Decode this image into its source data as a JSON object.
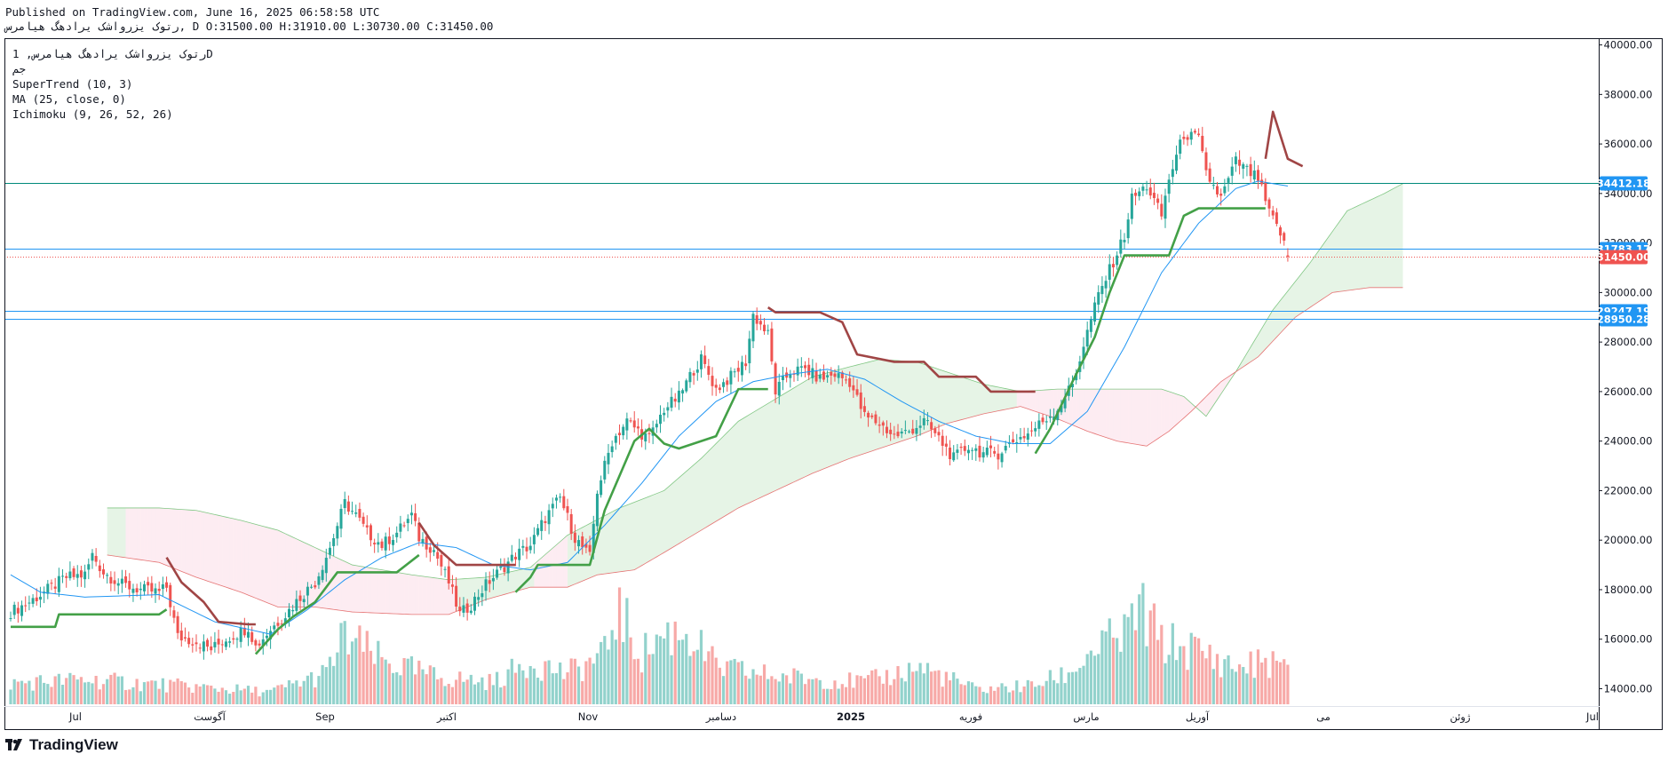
{
  "header": {
    "published": "Published on TradingView.com, June 16, 2025 06:58:58 UTC",
    "ohlc": "رتوک یزرواشک یرادهگ هیامرس, D O:31500.00 H:31910.00 L:30730.00 C:31450.00"
  },
  "legend": {
    "symbol": "رتوک یزرواشک یرادهگ هیامرس, 1D",
    "sub": "جم",
    "supertrend": "SuperTrend (10, 3)",
    "ma": "MA (25, close, 0)",
    "ichimoku": "Ichimoku (9, 26, 52, 26)"
  },
  "footer": {
    "brand": "TradingView"
  },
  "colors": {
    "up": "#26a69a",
    "down": "#ef5350",
    "ma": "#2196f3",
    "supertrend_up": "#43a047",
    "supertrend_down": "#a04545",
    "kumo_bull": "#a5d6a7",
    "kumo_bear": "#f8bbd0",
    "hline_teal": "#00897b",
    "hline_blue": "#2196f3",
    "last_price": "#ef5350"
  },
  "chart_data": {
    "type": "candlestick",
    "y_axis": {
      "min": 13300,
      "max": 40200,
      "ticks": [
        "40000.00",
        "38000.00",
        "36000.00",
        "34000.00",
        "32000.00",
        "30000.00",
        "28000.00",
        "26000.00",
        "24000.00",
        "22000.00",
        "20000.00",
        "18000.00",
        "16000.00",
        "14000.00"
      ]
    },
    "x_axis": {
      "labels": [
        "Jul",
        "آگوست",
        "Sep",
        "اکتبر",
        "Nov",
        "دسامبر",
        "2025",
        "فوریه",
        "مارس",
        "آوریل",
        "می",
        "ژوئن",
        "Jul"
      ]
    },
    "close_path": [
      [
        0,
        17100
      ],
      [
        5,
        17500
      ],
      [
        10,
        18000
      ],
      [
        15,
        18500
      ],
      [
        20,
        18600
      ],
      [
        22,
        19400
      ],
      [
        25,
        18700
      ],
      [
        30,
        18200
      ],
      [
        35,
        18000
      ],
      [
        40,
        17900
      ],
      [
        42,
        18100
      ],
      [
        45,
        16100
      ],
      [
        50,
        15900
      ],
      [
        54,
        15600
      ],
      [
        58,
        16000
      ],
      [
        62,
        16300
      ],
      [
        64,
        16500
      ],
      [
        66,
        15700
      ],
      [
        70,
        16400
      ],
      [
        74,
        17000
      ],
      [
        78,
        17700
      ],
      [
        82,
        18300
      ],
      [
        86,
        19700
      ],
      [
        90,
        21500
      ],
      [
        93,
        21000
      ],
      [
        96,
        20300
      ],
      [
        100,
        19800
      ],
      [
        104,
        20300
      ],
      [
        108,
        21000
      ],
      [
        110,
        20100
      ],
      [
        114,
        19600
      ],
      [
        118,
        18300
      ],
      [
        121,
        17000
      ],
      [
        124,
        17400
      ],
      [
        128,
        18200
      ],
      [
        132,
        18800
      ],
      [
        136,
        19400
      ],
      [
        140,
        19800
      ],
      [
        144,
        20900
      ],
      [
        148,
        21700
      ],
      [
        152,
        20100
      ],
      [
        156,
        19300
      ],
      [
        158,
        22000
      ],
      [
        162,
        24000
      ],
      [
        166,
        24800
      ],
      [
        170,
        24300
      ],
      [
        172,
        24100
      ],
      [
        176,
        25300
      ],
      [
        180,
        25800
      ],
      [
        184,
        26900
      ],
      [
        186,
        27300
      ],
      [
        190,
        26100
      ],
      [
        194,
        26600
      ],
      [
        198,
        27200
      ],
      [
        200,
        29100
      ],
      [
        204,
        28300
      ],
      [
        206,
        26000
      ],
      [
        210,
        26800
      ],
      [
        214,
        26900
      ],
      [
        218,
        26500
      ],
      [
        222,
        26700
      ],
      [
        226,
        26400
      ],
      [
        230,
        25000
      ],
      [
        234,
        24700
      ],
      [
        238,
        24200
      ],
      [
        242,
        24400
      ],
      [
        246,
        24800
      ],
      [
        250,
        24100
      ],
      [
        254,
        23300
      ],
      [
        258,
        23800
      ],
      [
        262,
        23500
      ],
      [
        266,
        23500
      ],
      [
        270,
        24000
      ],
      [
        274,
        24300
      ],
      [
        278,
        24800
      ],
      [
        282,
        25300
      ],
      [
        286,
        26300
      ],
      [
        290,
        28400
      ],
      [
        293,
        29900
      ],
      [
        296,
        30900
      ],
      [
        300,
        32300
      ],
      [
        302,
        33800
      ],
      [
        306,
        34300
      ],
      [
        310,
        33100
      ],
      [
        312,
        34600
      ],
      [
        316,
        36400
      ],
      [
        320,
        36200
      ],
      [
        322,
        34800
      ],
      [
        326,
        33800
      ],
      [
        330,
        35300
      ],
      [
        334,
        34800
      ],
      [
        336,
        34600
      ],
      [
        339,
        33200
      ],
      [
        342,
        32400
      ],
      [
        344,
        31450
      ]
    ],
    "vol_path": [
      [
        0,
        0.17
      ],
      [
        20,
        0.2
      ],
      [
        45,
        0.15
      ],
      [
        70,
        0.1
      ],
      [
        85,
        0.25
      ],
      [
        90,
        0.55
      ],
      [
        95,
        0.45
      ],
      [
        100,
        0.35
      ],
      [
        115,
        0.22
      ],
      [
        130,
        0.18
      ],
      [
        140,
        0.35
      ],
      [
        150,
        0.25
      ],
      [
        160,
        0.4
      ],
      [
        163,
        0.78
      ],
      [
        170,
        0.4
      ],
      [
        175,
        0.55
      ],
      [
        182,
        0.6
      ],
      [
        190,
        0.3
      ],
      [
        200,
        0.25
      ],
      [
        210,
        0.22
      ],
      [
        230,
        0.18
      ],
      [
        245,
        0.3
      ],
      [
        260,
        0.12
      ],
      [
        275,
        0.15
      ],
      [
        285,
        0.25
      ],
      [
        292,
        0.45
      ],
      [
        300,
        0.55
      ],
      [
        304,
        0.78
      ],
      [
        310,
        0.5
      ],
      [
        318,
        0.45
      ],
      [
        330,
        0.3
      ],
      [
        340,
        0.35
      ],
      [
        344,
        0.25
      ]
    ],
    "tenkan_kijun_note": "",
    "ma_path": [
      [
        0,
        18600
      ],
      [
        8,
        17900
      ],
      [
        20,
        17700
      ],
      [
        40,
        17800
      ],
      [
        55,
        16700
      ],
      [
        70,
        16200
      ],
      [
        80,
        17200
      ],
      [
        90,
        18400
      ],
      [
        100,
        19300
      ],
      [
        110,
        19900
      ],
      [
        120,
        19700
      ],
      [
        130,
        19000
      ],
      [
        140,
        18800
      ],
      [
        150,
        19100
      ],
      [
        160,
        20600
      ],
      [
        170,
        22300
      ],
      [
        180,
        24200
      ],
      [
        190,
        25600
      ],
      [
        200,
        26400
      ],
      [
        210,
        26700
      ],
      [
        220,
        26900
      ],
      [
        230,
        26500
      ],
      [
        240,
        25600
      ],
      [
        250,
        24800
      ],
      [
        260,
        24200
      ],
      [
        270,
        23900
      ],
      [
        280,
        23900
      ],
      [
        290,
        25200
      ],
      [
        300,
        27800
      ],
      [
        310,
        30800
      ],
      [
        320,
        32800
      ],
      [
        330,
        34200
      ],
      [
        336,
        34500
      ],
      [
        344,
        34300
      ]
    ],
    "supertrend": [
      {
        "trend": "up",
        "points": [
          [
            0,
            16500
          ],
          [
            12,
            16500
          ],
          [
            13,
            17000
          ],
          [
            40,
            17000
          ],
          [
            42,
            17200
          ]
        ]
      },
      {
        "trend": "down",
        "points": [
          [
            42,
            19300
          ],
          [
            46,
            18300
          ],
          [
            52,
            17500
          ],
          [
            56,
            16700
          ],
          [
            64,
            16600
          ],
          [
            66,
            16600
          ]
        ]
      },
      {
        "trend": "up",
        "points": [
          [
            66,
            15400
          ],
          [
            72,
            16400
          ],
          [
            76,
            16900
          ],
          [
            82,
            17500
          ],
          [
            88,
            18700
          ],
          [
            104,
            18700
          ],
          [
            110,
            19400
          ]
        ]
      },
      {
        "trend": "down",
        "points": [
          [
            110,
            20700
          ],
          [
            114,
            19800
          ],
          [
            120,
            19000
          ],
          [
            136,
            19000
          ]
        ]
      },
      {
        "trend": "up",
        "points": [
          [
            136,
            17900
          ],
          [
            140,
            18500
          ],
          [
            142,
            19000
          ],
          [
            156,
            19000
          ],
          [
            160,
            21200
          ],
          [
            168,
            24000
          ],
          [
            172,
            24500
          ],
          [
            176,
            23900
          ],
          [
            180,
            23700
          ],
          [
            190,
            24200
          ],
          [
            196,
            26100
          ],
          [
            204,
            26100
          ]
        ]
      },
      {
        "trend": "down",
        "points": [
          [
            204,
            29400
          ],
          [
            206,
            29200
          ],
          [
            218,
            29200
          ],
          [
            224,
            28800
          ],
          [
            228,
            27500
          ],
          [
            238,
            27200
          ],
          [
            246,
            27200
          ],
          [
            250,
            26600
          ],
          [
            260,
            26600
          ],
          [
            264,
            26000
          ],
          [
            276,
            26000
          ]
        ]
      },
      {
        "trend": "up",
        "points": [
          [
            276,
            23500
          ],
          [
            280,
            24500
          ],
          [
            286,
            26400
          ],
          [
            292,
            28200
          ],
          [
            296,
            30000
          ],
          [
            300,
            31500
          ],
          [
            312,
            31500
          ],
          [
            316,
            33100
          ],
          [
            320,
            33400
          ],
          [
            338,
            33400
          ]
        ]
      },
      {
        "trend": "down",
        "points": [
          [
            338,
            35400
          ],
          [
            340,
            37300
          ],
          [
            344,
            35400
          ],
          [
            348,
            35100
          ]
        ]
      }
    ],
    "kumo_upper": [
      [
        26,
        21300
      ],
      [
        40,
        21300
      ],
      [
        50,
        21200
      ],
      [
        62,
        20800
      ],
      [
        72,
        20400
      ],
      [
        82,
        19700
      ],
      [
        92,
        19000
      ],
      [
        108,
        18600
      ],
      [
        118,
        18400
      ],
      [
        128,
        18500
      ],
      [
        140,
        18900
      ],
      [
        150,
        20200
      ],
      [
        164,
        21300
      ],
      [
        176,
        22000
      ],
      [
        186,
        23300
      ],
      [
        196,
        24800
      ],
      [
        206,
        25700
      ],
      [
        216,
        26600
      ],
      [
        226,
        27000
      ],
      [
        234,
        27300
      ],
      [
        244,
        27200
      ],
      [
        252,
        26800
      ],
      [
        262,
        26300
      ],
      [
        272,
        26000
      ],
      [
        282,
        26100
      ],
      [
        290,
        26100
      ],
      [
        298,
        26100
      ],
      [
        310,
        26100
      ],
      [
        316,
        25800
      ],
      [
        322,
        25000
      ],
      [
        330,
        26800
      ],
      [
        340,
        29300
      ],
      [
        350,
        31200
      ],
      [
        360,
        33300
      ],
      [
        370,
        34000
      ],
      [
        375,
        34400
      ]
    ],
    "kumo_lower": [
      [
        26,
        19400
      ],
      [
        40,
        19100
      ],
      [
        50,
        18500
      ],
      [
        62,
        17900
      ],
      [
        72,
        17300
      ],
      [
        82,
        17300
      ],
      [
        92,
        17100
      ],
      [
        108,
        17000
      ],
      [
        118,
        17000
      ],
      [
        128,
        17600
      ],
      [
        140,
        18100
      ],
      [
        150,
        18100
      ],
      [
        158,
        18600
      ],
      [
        168,
        18800
      ],
      [
        176,
        19500
      ],
      [
        186,
        20400
      ],
      [
        196,
        21300
      ],
      [
        206,
        22000
      ],
      [
        216,
        22700
      ],
      [
        226,
        23300
      ],
      [
        236,
        23800
      ],
      [
        244,
        24200
      ],
      [
        252,
        24700
      ],
      [
        262,
        25100
      ],
      [
        272,
        25400
      ],
      [
        282,
        24900
      ],
      [
        290,
        24400
      ],
      [
        298,
        24000
      ],
      [
        306,
        23800
      ],
      [
        312,
        24400
      ],
      [
        318,
        25200
      ],
      [
        326,
        26400
      ],
      [
        336,
        27400
      ],
      [
        346,
        29000
      ],
      [
        356,
        30000
      ],
      [
        366,
        30200
      ],
      [
        375,
        30200
      ]
    ],
    "kumo_bull_ranges": [
      [
        26,
        30
      ],
      [
        120,
        140
      ],
      [
        150,
        270
      ],
      [
        330,
        375
      ]
    ],
    "hlines": [
      {
        "price": 34412.18,
        "label": "34412.18",
        "color": "#00897b"
      },
      {
        "price": 31783.17,
        "label": "31783.17",
        "color": "#2196f3"
      },
      {
        "price": 29247.19,
        "label": "29247.19",
        "color": "#2196f3"
      },
      {
        "price": 28950.28,
        "label": "28950.28",
        "color": "#2196f3"
      }
    ],
    "last_price": {
      "price": 31450.0,
      "label": "31450.00"
    }
  }
}
